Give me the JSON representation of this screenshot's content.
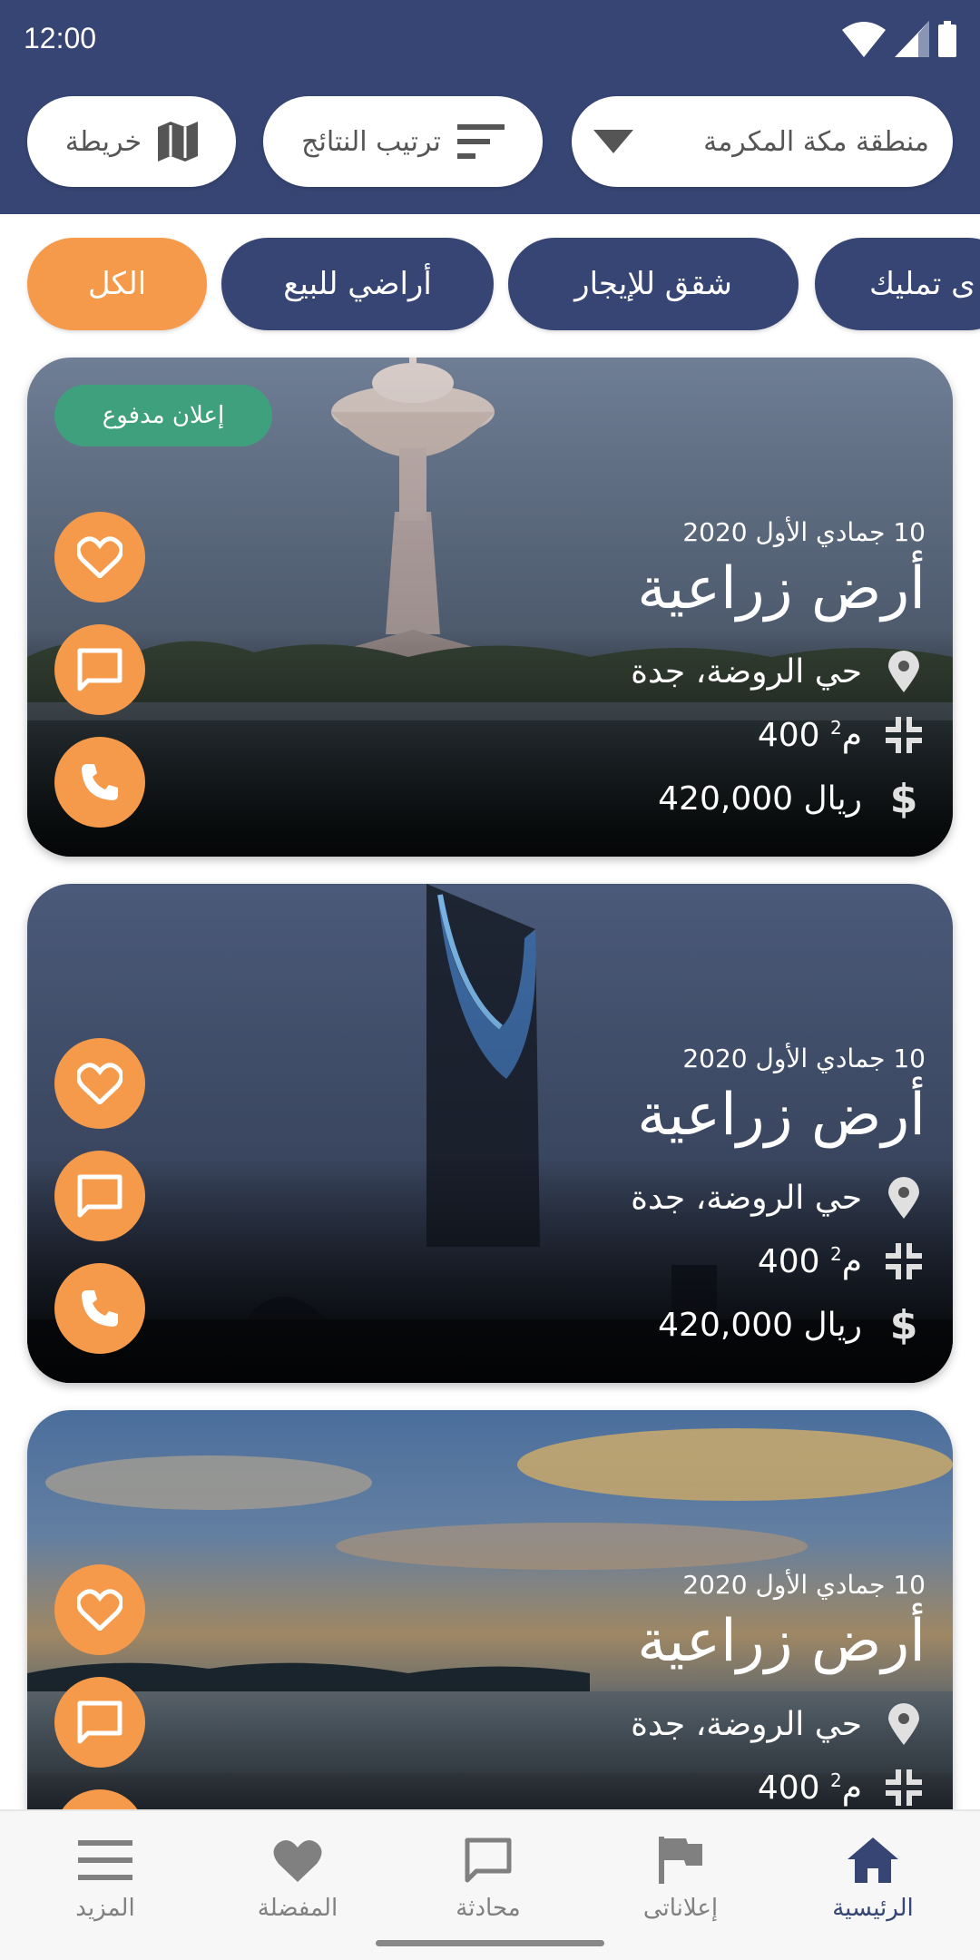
{
  "status_bar": {
    "time": "12:00"
  },
  "header": {
    "region_label": "منطقة مكة المكرمة",
    "sort_label": "ترتيب النتائج",
    "map_label": "خريطة"
  },
  "filters": {
    "all": "الكل",
    "land_sale": "أراضي للبيع",
    "apartments_rent": "شقق للإيجار",
    "ownership_partial": "ى تمليك"
  },
  "cards": [
    {
      "badge": "إعلان مدفوع",
      "date": "10 جمادي الأول 2020",
      "title": "أرض زراعية",
      "location": "حي الروضة، جدة",
      "area": "400 م",
      "area_sup": "2",
      "price": "420,000 ريال"
    },
    {
      "date": "10 جمادي الأول 2020",
      "title": "أرض زراعية",
      "location": "حي الروضة، جدة",
      "area": "400 م",
      "area_sup": "2",
      "price": "420,000 ريال"
    },
    {
      "date": "10 جمادي الأول 2020",
      "title": "أرض زراعية",
      "location": "حي الروضة، جدة",
      "area": "400 م",
      "area_sup": "2"
    }
  ],
  "bottom_nav": {
    "home": "الرئيسية",
    "my_ads": "إعلاناتى",
    "chat": "محادثة",
    "favorites": "المفضلة",
    "more": "المزيد"
  },
  "colors": {
    "primary": "#364573",
    "accent": "#f59a4a",
    "badge": "#3fa07e"
  }
}
